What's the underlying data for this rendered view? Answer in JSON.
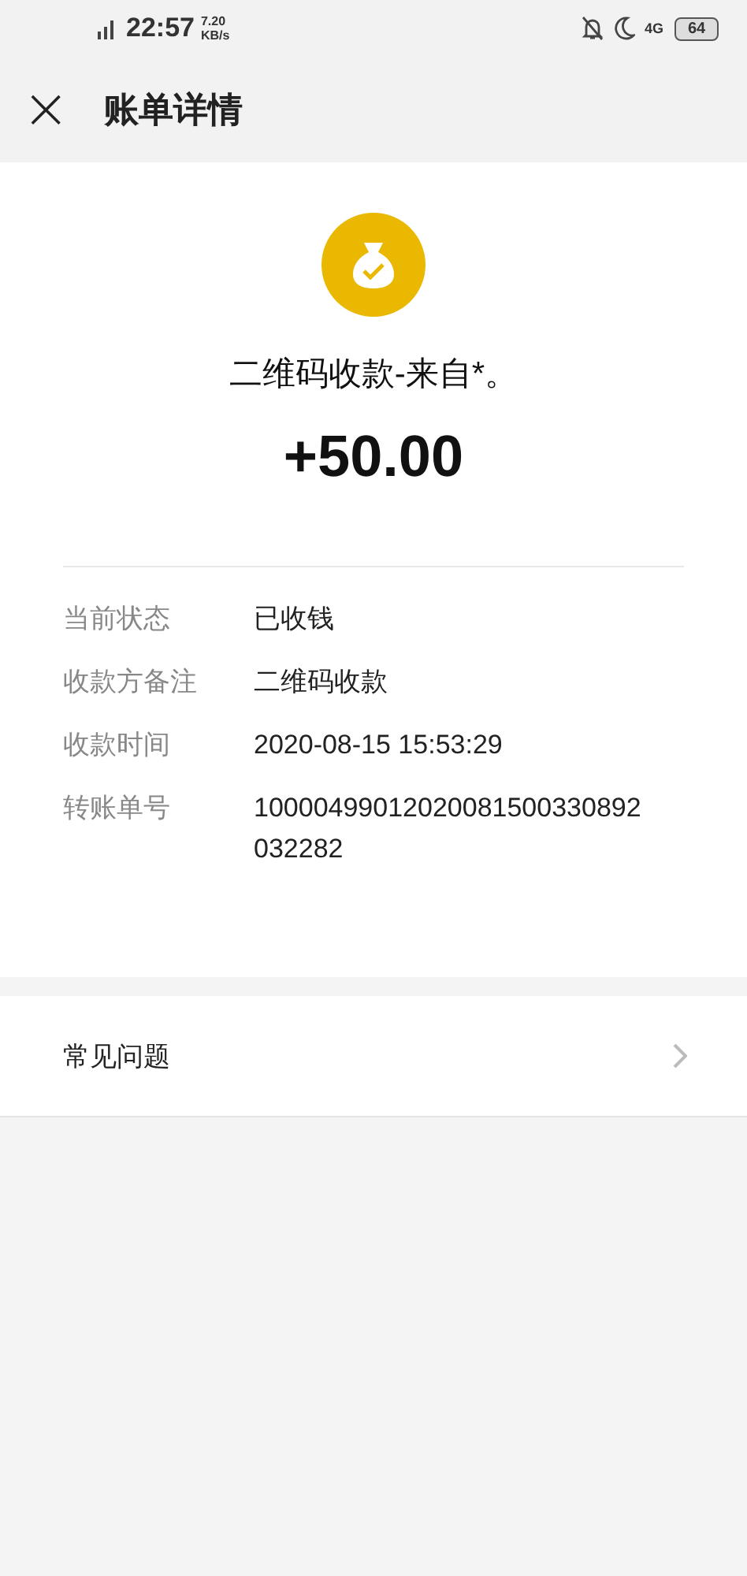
{
  "status_bar": {
    "time": "22:57",
    "net_speed": "7.20",
    "net_unit": "KB/s",
    "network": "4G",
    "battery": "64"
  },
  "header": {
    "close": "×",
    "title": "账单详情"
  },
  "summary": {
    "description": "二维码收款-来自*。",
    "amount": "+50.00"
  },
  "details": [
    {
      "label": "当前状态",
      "value": "已收钱"
    },
    {
      "label": "收款方备注",
      "value": "二维码收款"
    },
    {
      "label": "收款时间",
      "value": "2020-08-15 15:53:29"
    },
    {
      "label": "转账单号",
      "value": "10000499012020081500330892032282"
    }
  ],
  "faq": {
    "label": "常见问题"
  }
}
